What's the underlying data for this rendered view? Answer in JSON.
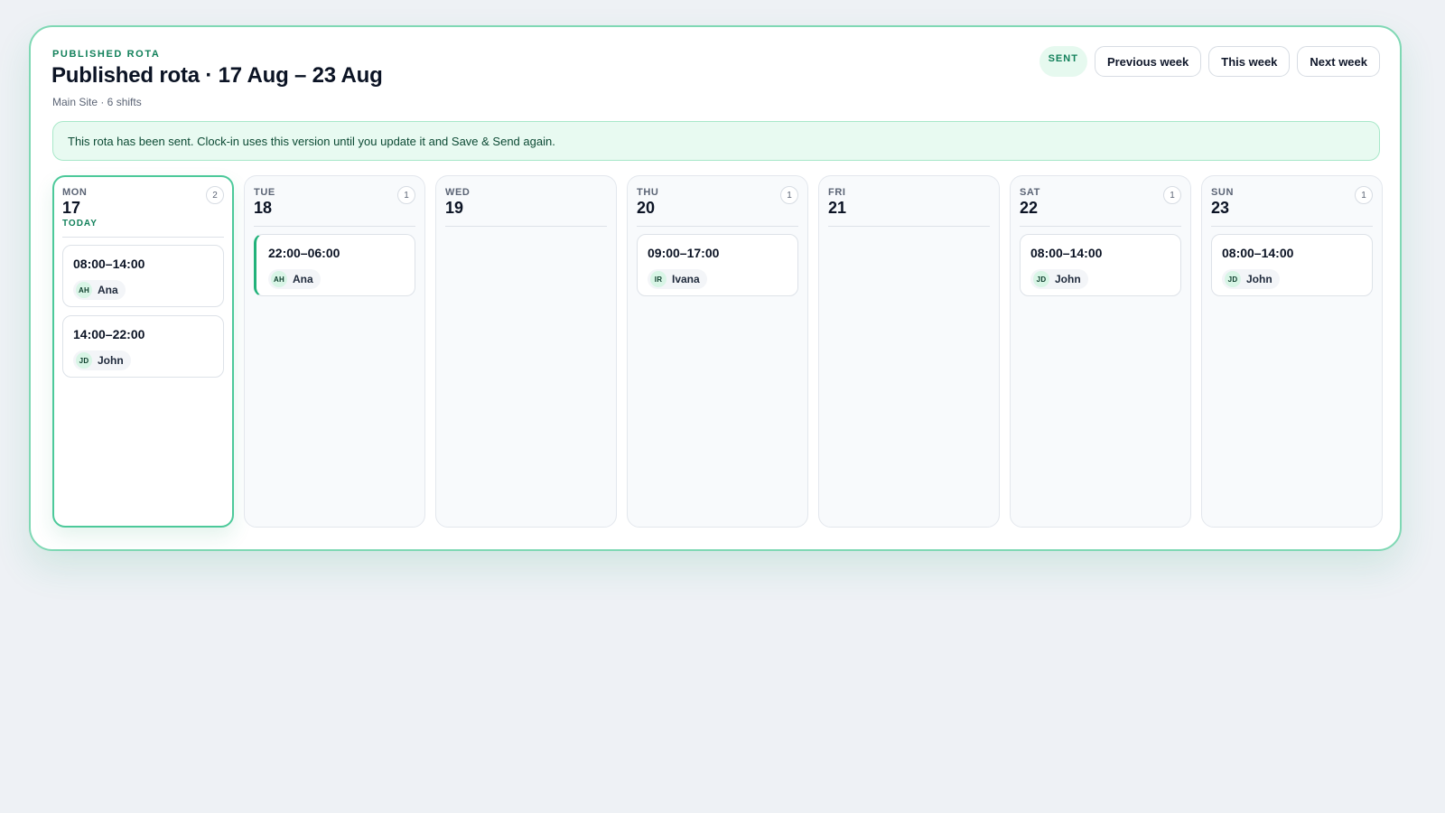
{
  "header": {
    "eyebrow": "PUBLISHED ROTA",
    "title": "Published rota · 17 Aug – 23 Aug",
    "subtitle": "Main Site · 6 shifts"
  },
  "actions": {
    "status": "SENT",
    "previous_week": "Previous week",
    "this_week": "This week",
    "next_week": "Next week"
  },
  "notice": "This rota has been sent. Clock-in uses this version until you update it and Save & Send again.",
  "colors": {
    "accent": "#22b27a",
    "accent_dark": "#11805a",
    "notice_bg": "#e8faf1",
    "panel_border": "#7fd8b4"
  },
  "days": [
    {
      "name": "MON",
      "date": "17",
      "today_label": "TODAY",
      "count": "2",
      "shifts": [
        {
          "time": "08:00–14:00",
          "initials": "AH",
          "name": "Ana"
        },
        {
          "time": "14:00–22:00",
          "initials": "JD",
          "name": "John"
        }
      ]
    },
    {
      "name": "TUE",
      "date": "18",
      "count": "1",
      "shifts": [
        {
          "time": "22:00–06:00",
          "initials": "AH",
          "name": "Ana"
        }
      ]
    },
    {
      "name": "WED",
      "date": "19"
    },
    {
      "name": "THU",
      "date": "20",
      "count": "1",
      "shifts": [
        {
          "time": "09:00–17:00",
          "initials": "IR",
          "name": "Ivana"
        }
      ]
    },
    {
      "name": "FRI",
      "date": "21"
    },
    {
      "name": "SAT",
      "date": "22",
      "count": "1",
      "shifts": [
        {
          "time": "08:00–14:00",
          "initials": "JD",
          "name": "John"
        }
      ]
    },
    {
      "name": "SUN",
      "date": "23",
      "count": "1",
      "shifts": [
        {
          "time": "08:00–14:00",
          "initials": "JD",
          "name": "John"
        }
      ]
    }
  ]
}
